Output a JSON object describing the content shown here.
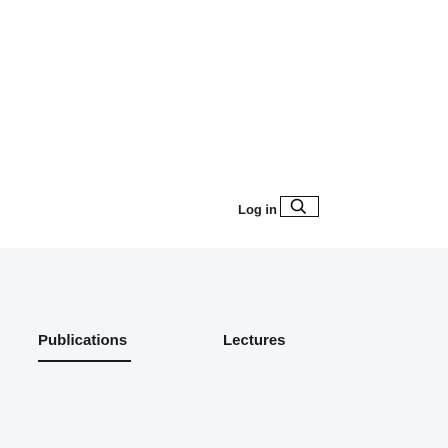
{
  "header": {
    "login_label": "Log in",
    "search_icon": "search-icon"
  },
  "tabs": [
    {
      "label": "Publications",
      "active": true
    },
    {
      "label": "Lectures",
      "active": false
    }
  ],
  "colors": {
    "background": "#ffffff",
    "section_background": "#f5f6f8",
    "text": "#1a1a1a",
    "border": "#111111"
  }
}
